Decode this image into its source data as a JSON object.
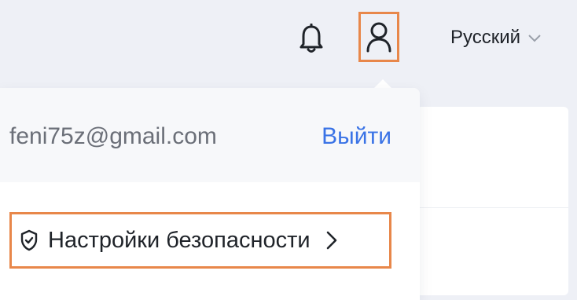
{
  "header": {
    "notification_icon": "bell-icon",
    "user_icon": "user-icon",
    "language": {
      "label": "Русский",
      "icon": "chevron-down-icon"
    }
  },
  "account_menu": {
    "email": "feni75z@gmail.com",
    "logout_label": "Выйти",
    "items": [
      {
        "icon": "shield-icon",
        "label": "Настройки безопасности",
        "trailing_icon": "chevron-right-icon"
      }
    ]
  },
  "colors": {
    "highlight": "#e8874a",
    "link": "#3a73e6",
    "page_background": "#eef0f6"
  }
}
